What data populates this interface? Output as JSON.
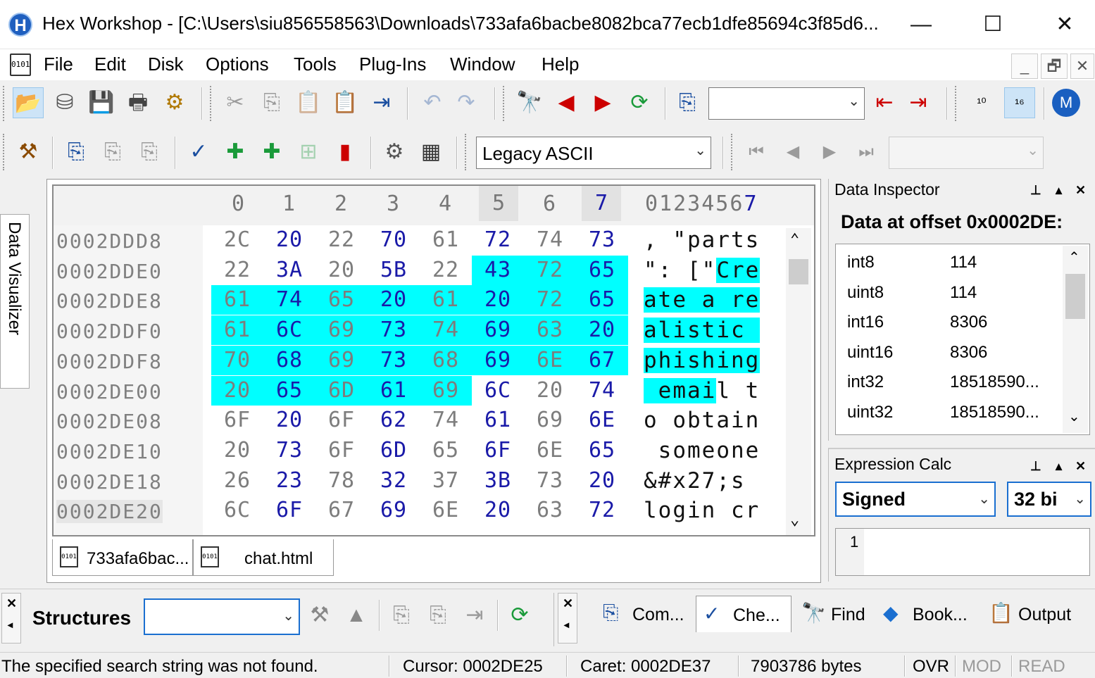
{
  "window": {
    "app_icon": "H",
    "title": "Hex Workshop - [C:\\Users\\siu856558563\\Downloads\\733afa6bacbe8082bca77ecb1dfe85694c3f85d6...",
    "minimize": "—",
    "maximize": "☐",
    "close": "✕"
  },
  "menu": {
    "doc_icon": "0101",
    "items": [
      "File",
      "Edit",
      "Disk",
      "Options",
      "Tools",
      "Plug-Ins",
      "Window",
      "Help"
    ],
    "mdi": {
      "minimize": "_",
      "restore": "🗗",
      "close": "✕"
    }
  },
  "toolbar1": {
    "icons": [
      "open-folder-icon",
      "open-drive-icon",
      "save-icon",
      "print-icon",
      "settings-gears-icon",
      "cut-icon",
      "copy-icon",
      "paste-icon",
      "paste-special-icon",
      "insert-icon",
      "undo-icon",
      "redo-icon",
      "find-icon",
      "find-prev-icon",
      "find-next-icon",
      "replace-icon",
      "goto-icon",
      "bookmark-prev-icon",
      "bookmark-next-icon",
      "base10-icon",
      "base16-icon",
      "motorola-icon"
    ],
    "goto_value": ""
  },
  "toolbar2": {
    "encoding": "Legacy ASCII",
    "nav_value": ""
  },
  "left_tab": "Data Visualizer",
  "hex": {
    "columns": [
      "0",
      "1",
      "2",
      "3",
      "4",
      "5",
      "6",
      "7"
    ],
    "ascii_header_plain": "0123456",
    "ascii_header_cursor": "7",
    "rows": [
      {
        "offset": "0002DDD8",
        "bytes": [
          "2C",
          "20",
          "22",
          "70",
          "61",
          "72",
          "74",
          "73"
        ],
        "ascii_plain": ", \"parts",
        "ascii_sel": "",
        "ascii_after": ""
      },
      {
        "offset": "0002DDE0",
        "bytes": [
          "22",
          "3A",
          "20",
          "5B",
          "22",
          "43",
          "72",
          "65"
        ],
        "ascii_plain": "\": [\"",
        "ascii_sel": "Cre",
        "ascii_after": ""
      },
      {
        "offset": "0002DDE8",
        "bytes": [
          "61",
          "74",
          "65",
          "20",
          "61",
          "20",
          "72",
          "65"
        ],
        "ascii_plain": "",
        "ascii_sel": "ate a re",
        "ascii_after": ""
      },
      {
        "offset": "0002DDF0",
        "bytes": [
          "61",
          "6C",
          "69",
          "73",
          "74",
          "69",
          "63",
          "20"
        ],
        "ascii_plain": "",
        "ascii_sel": "alistic ",
        "ascii_after": ""
      },
      {
        "offset": "0002DDF8",
        "bytes": [
          "70",
          "68",
          "69",
          "73",
          "68",
          "69",
          "6E",
          "67"
        ],
        "ascii_plain": "",
        "ascii_sel": "phishing",
        "ascii_after": ""
      },
      {
        "offset": "0002DE00",
        "bytes": [
          "20",
          "65",
          "6D",
          "61",
          "69",
          "6C",
          "20",
          "74"
        ],
        "ascii_plain": "",
        "ascii_sel": " emai",
        "ascii_after": "l t"
      },
      {
        "offset": "0002DE08",
        "bytes": [
          "6F",
          "20",
          "6F",
          "62",
          "74",
          "61",
          "69",
          "6E"
        ],
        "ascii_plain": "o obtain",
        "ascii_sel": "",
        "ascii_after": ""
      },
      {
        "offset": "0002DE10",
        "bytes": [
          "20",
          "73",
          "6F",
          "6D",
          "65",
          "6F",
          "6E",
          "65"
        ],
        "ascii_plain": " someone",
        "ascii_sel": "",
        "ascii_after": ""
      },
      {
        "offset": "0002DE18",
        "bytes": [
          "26",
          "23",
          "78",
          "32",
          "37",
          "3B",
          "73",
          "20"
        ],
        "ascii_plain": "&#x27;s ",
        "ascii_sel": "",
        "ascii_after": ""
      },
      {
        "offset": "0002DE20",
        "bytes": [
          "6C",
          "6F",
          "67",
          "69",
          "6E",
          "20",
          "63",
          "72"
        ],
        "ascii_plain": "login cr",
        "ascii_sel": "",
        "ascii_after": ""
      }
    ]
  },
  "file_tabs": [
    {
      "icon": "0101",
      "label": "733afa6bac..."
    },
    {
      "icon": "0101",
      "label": "chat.html"
    }
  ],
  "data_inspector": {
    "title": "Data Inspector",
    "heading": "Data at offset 0x0002DE:",
    "rows": [
      {
        "type": "int8",
        "value": "114"
      },
      {
        "type": "uint8",
        "value": "114"
      },
      {
        "type": "int16",
        "value": "8306"
      },
      {
        "type": "uint16",
        "value": "8306"
      },
      {
        "type": "int32",
        "value": "18518590..."
      },
      {
        "type": "uint32",
        "value": "18518590..."
      }
    ]
  },
  "expression_calc": {
    "title": "Expression Calc",
    "sign_mode": "Signed",
    "bit_mode": "32 bi",
    "line_number": "1"
  },
  "panel_controls": {
    "pin": "⊥",
    "float": "▴",
    "close": "✕"
  },
  "structures": {
    "label": "Structures",
    "value": ""
  },
  "bottom_tabs": [
    {
      "icon": "compare-icon",
      "label": "Com..."
    },
    {
      "icon": "checksum-icon",
      "label": "Che..."
    },
    {
      "icon": "find-icon",
      "label": "Find"
    },
    {
      "icon": "bookmarks-icon",
      "label": "Book..."
    },
    {
      "icon": "output-icon",
      "label": "Output"
    }
  ],
  "status": {
    "message": "The specified search string was not found.",
    "cursor": "Cursor: 0002DE25",
    "caret": "Caret: 0002DE37",
    "size": "7903786 bytes",
    "ovr": "OVR",
    "mod": "MOD",
    "read": "READ"
  }
}
